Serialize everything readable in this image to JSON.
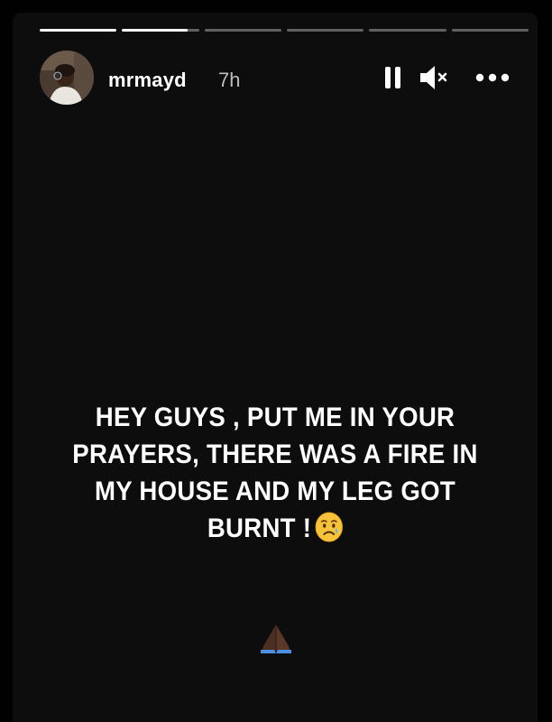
{
  "story": {
    "username": "mrmayd",
    "time_ago": "7h",
    "progress": [
      1.0,
      0.85,
      0,
      0,
      0,
      0
    ],
    "caption_lines": [
      "HEY GUYS , PUT ME IN YOUR",
      "PRAYERS, THERE WAS A FIRE IN",
      "MY HOUSE AND MY LEG GOT",
      "BURNT !"
    ],
    "caption_emoji": "sad-but-relieved-face",
    "bottom_emoji": "folded-hands"
  },
  "controls": {
    "pause_icon": "pause-icon",
    "mute_icon": "muted-speaker-icon",
    "more_icon": "more-options-icon"
  },
  "colors": {
    "background": "#000000",
    "story_bg": "#0d0d0e",
    "text": "#ffffff",
    "secondary_text": "#bdbdbd",
    "progress_track": "rgba(255,255,255,0.35)",
    "progress_fill": "#ffffff"
  }
}
